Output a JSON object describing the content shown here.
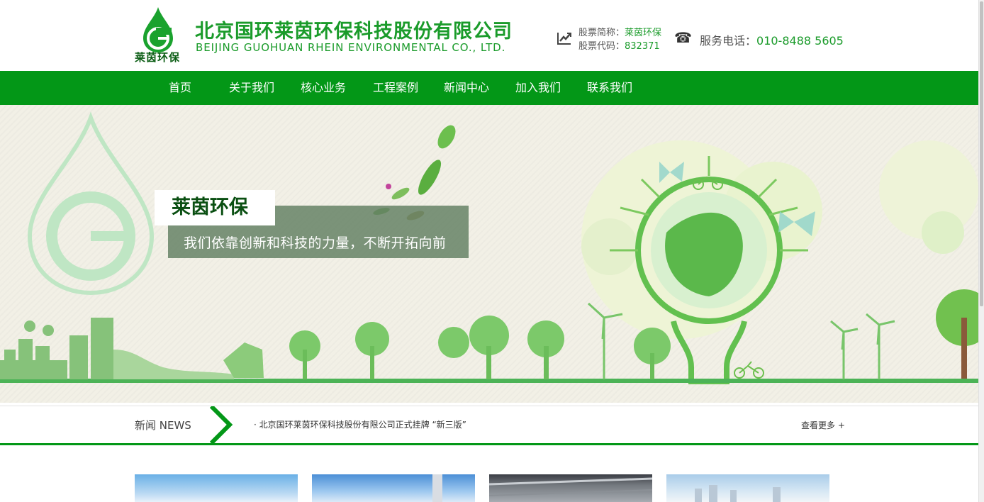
{
  "header": {
    "logo_text": "莱茵环保",
    "company_cn": "北京国环莱茵环保科技股份有限公司",
    "company_en": "BEIJING  GUOHUAN  RHEIN  ENVIRONMENTAL CO., LTD.",
    "stock_name_label": "股票简称：",
    "stock_name_value": "莱茵环保",
    "stock_code_label": "股票代码：",
    "stock_code_value": "832371",
    "phone_label": "服务电话：",
    "phone_value": "010-8488 5605"
  },
  "nav": {
    "items": [
      {
        "label": "首页"
      },
      {
        "label": "关于我们"
      },
      {
        "label": "核心业务"
      },
      {
        "label": "工程案例"
      },
      {
        "label": "新闻中心"
      },
      {
        "label": "加入我们"
      },
      {
        "label": "联系我们"
      }
    ]
  },
  "banner": {
    "title": "莱茵环保",
    "subtitle": "我们依靠创新和科技的力量，不断开拓向前"
  },
  "news": {
    "label": "新闻 NEWS",
    "item": "· 北京国环莱茵环保科技股份有限公司正式挂牌  “新三版”",
    "more": "查看更多 +"
  },
  "colors": {
    "brand_green": "#039717",
    "text_green": "#1a9b2a",
    "banner_bg": "#f2f0e6"
  },
  "icons": {
    "stock": "trend-chart-icon",
    "phone": "telephone-icon",
    "news_arrow": "chevron-right-icon"
  }
}
